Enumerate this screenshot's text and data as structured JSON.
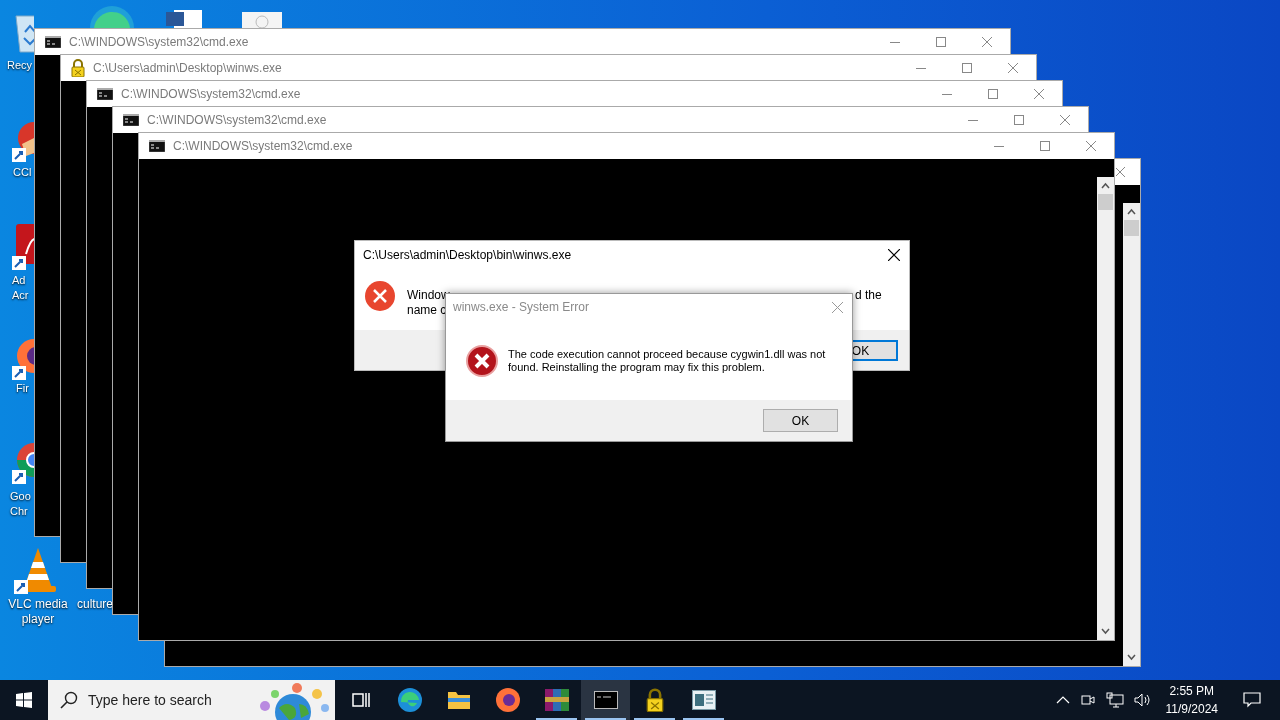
{
  "desktop_icons": [
    {
      "kind": "recycle",
      "lines": [
        "Recy"
      ]
    },
    {
      "kind": "ccleaner",
      "lines": [
        "CCl"
      ]
    },
    {
      "kind": "acrobat",
      "lines": [
        "Ad",
        "Acr"
      ]
    },
    {
      "kind": "firefox",
      "lines": [
        "Fir"
      ]
    },
    {
      "kind": "chrome",
      "lines": [
        "Goo",
        "Chr"
      ]
    },
    {
      "kind": "vlc",
      "lines": [
        "VLC media",
        "player"
      ]
    },
    {
      "kind": "file",
      "lines": [
        "culture"
      ]
    }
  ],
  "windows": [
    {
      "kind": "hidden"
    },
    {
      "kind": "console",
      "title": "C:\\WINDOWS\\system32\\cmd.exe"
    },
    {
      "kind": "lock",
      "title": "C:\\Users\\admin\\Desktop\\winws.exe"
    },
    {
      "kind": "console",
      "title": "C:\\WINDOWS\\system32\\cmd.exe"
    },
    {
      "kind": "console",
      "title": "C:\\WINDOWS\\system32\\cmd.exe"
    },
    {
      "kind": "console",
      "title": "C:\\WINDOWS\\system32\\cmd.exe"
    }
  ],
  "run_error_dialog": {
    "title": "C:\\Users\\admin\\Desktop\\bin\\winws.exe",
    "message_fragments": [
      "Window",
      "d the",
      "name c"
    ],
    "button": "OK"
  },
  "system_error_dialog": {
    "title": "winws.exe - System Error",
    "message": "The code execution cannot proceed because cygwin1.dll was not found. Reinstalling the program may fix this problem.",
    "button": "OK"
  },
  "taskbar": {
    "search_placeholder": "Type here to search",
    "apps": [
      {
        "kind": "taskview",
        "running": false,
        "selected": false
      },
      {
        "kind": "edge",
        "running": false,
        "selected": false
      },
      {
        "kind": "explorer",
        "running": false,
        "selected": false
      },
      {
        "kind": "firefox",
        "running": false,
        "selected": false
      },
      {
        "kind": "winrar",
        "running": true,
        "selected": false
      },
      {
        "kind": "console",
        "running": true,
        "selected": true
      },
      {
        "kind": "lock",
        "running": true,
        "selected": false
      },
      {
        "kind": "app",
        "running": true,
        "selected": false
      }
    ],
    "time": "2:55 PM",
    "date": "11/9/2024"
  }
}
